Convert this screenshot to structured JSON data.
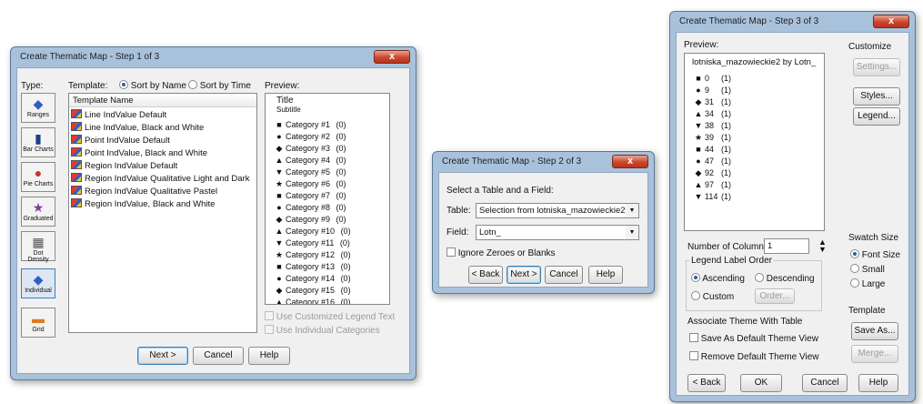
{
  "dialog1": {
    "title": "Create Thematic Map - Step 1 of 3",
    "close": "x",
    "type_label": "Type:",
    "template_label": "Template:",
    "sort_by_name": "Sort by Name",
    "sort_by_time": "Sort by Time",
    "preview_label": "Preview:",
    "types": [
      {
        "label": "Ranges",
        "icon": "ranges-icon",
        "glyph": "◆"
      },
      {
        "label": "Bar Charts",
        "icon": "bar-charts-icon",
        "glyph": "▮"
      },
      {
        "label": "Pie Charts",
        "icon": "pie-charts-icon",
        "glyph": "●"
      },
      {
        "label": "Graduated",
        "icon": "graduated-icon",
        "glyph": "★"
      },
      {
        "label": "Dot Density",
        "icon": "dot-density-icon",
        "glyph": "▦"
      },
      {
        "label": "Individual",
        "icon": "individual-icon",
        "glyph": "◆"
      },
      {
        "label": "Grid",
        "icon": "grid-icon",
        "glyph": "▬"
      }
    ],
    "template_header": "Template Name",
    "templates": [
      "Line IndValue Default",
      "Line IndValue, Black and White",
      "Point IndValue Default",
      "Point IndValue, Black and White",
      "Region IndValue Default",
      "Region IndValue Qualitative Light and Dark",
      "Region IndValue Qualitative Pastel",
      "Region IndValue, Black and White"
    ],
    "preview_title": "Title",
    "preview_subtitle": "Subtitle",
    "categories": [
      {
        "sym": "■",
        "label": "Category #1",
        "count": "(0)"
      },
      {
        "sym": "●",
        "label": "Category #2",
        "count": "(0)"
      },
      {
        "sym": "◆",
        "label": "Category #3",
        "count": "(0)"
      },
      {
        "sym": "▲",
        "label": "Category #4",
        "count": "(0)"
      },
      {
        "sym": "▼",
        "label": "Category #5",
        "count": "(0)"
      },
      {
        "sym": "★",
        "label": "Category #6",
        "count": "(0)"
      },
      {
        "sym": "■",
        "label": "Category #7",
        "count": "(0)"
      },
      {
        "sym": "●",
        "label": "Category #8",
        "count": "(0)"
      },
      {
        "sym": "◆",
        "label": "Category #9",
        "count": "(0)"
      },
      {
        "sym": "▲",
        "label": "Category #10",
        "count": "(0)"
      },
      {
        "sym": "▼",
        "label": "Category #11",
        "count": "(0)"
      },
      {
        "sym": "★",
        "label": "Category #12",
        "count": "(0)"
      },
      {
        "sym": "■",
        "label": "Category #13",
        "count": "(0)"
      },
      {
        "sym": "●",
        "label": "Category #14",
        "count": "(0)"
      },
      {
        "sym": "◆",
        "label": "Category #15",
        "count": "(0)"
      },
      {
        "sym": "▲",
        "label": "Category #16",
        "count": "(0)"
      }
    ],
    "use_customized_legend": "Use Customized Legend Text",
    "use_individual_categories": "Use Individual Categories",
    "next": "Next >",
    "cancel": "Cancel",
    "help": "Help"
  },
  "dialog2": {
    "title": "Create Thematic Map - Step 2 of 3",
    "close": "x",
    "instruction": "Select a Table and a Field:",
    "table_label": "Table:",
    "table_value": "Selection from lotniska_mazowieckie2",
    "field_label": "Field:",
    "field_value": "Lotn_",
    "ignore_zeroes": "Ignore Zeroes or Blanks",
    "back": "< Back",
    "next": "Next >",
    "cancel": "Cancel",
    "help": "Help"
  },
  "dialog3": {
    "title": "Create Thematic Map - Step 3 of 3",
    "close": "x",
    "preview_label": "Preview:",
    "preview_title": "lotniska_mazowieckie2 by Lotn_",
    "legend": [
      {
        "sym": "■",
        "value": "0",
        "count": "(1)"
      },
      {
        "sym": "●",
        "value": "9",
        "count": "(1)"
      },
      {
        "sym": "◆",
        "value": "31",
        "count": "(1)"
      },
      {
        "sym": "▲",
        "value": "34",
        "count": "(1)"
      },
      {
        "sym": "▼",
        "value": "38",
        "count": "(1)"
      },
      {
        "sym": "★",
        "value": "39",
        "count": "(1)"
      },
      {
        "sym": "■",
        "value": "44",
        "count": "(1)"
      },
      {
        "sym": "●",
        "value": "47",
        "count": "(1)"
      },
      {
        "sym": "◆",
        "value": "92",
        "count": "(1)"
      },
      {
        "sym": "▲",
        "value": "97",
        "count": "(1)"
      },
      {
        "sym": "▼",
        "value": "114",
        "count": "(1)"
      }
    ],
    "customize_label": "Customize",
    "settings": "Settings...",
    "styles": "Styles...",
    "legend_btn": "Legend...",
    "columns_label": "Number of Columns:",
    "columns_value": "1",
    "legend_label_order": "Legend Label Order",
    "ascending": "Ascending",
    "descending": "Descending",
    "custom": "Custom",
    "order": "Order...",
    "swatch_size": "Swatch Size",
    "font_size": "Font Size",
    "small": "Small",
    "large": "Large",
    "associate_label": "Associate Theme With Table",
    "save_default": "Save As Default Theme View",
    "remove_default": "Remove Default Theme View",
    "template_label": "Template",
    "save_as": "Save As...",
    "merge": "Merge...",
    "back": "< Back",
    "ok": "OK",
    "cancel": "Cancel",
    "help": "Help"
  }
}
